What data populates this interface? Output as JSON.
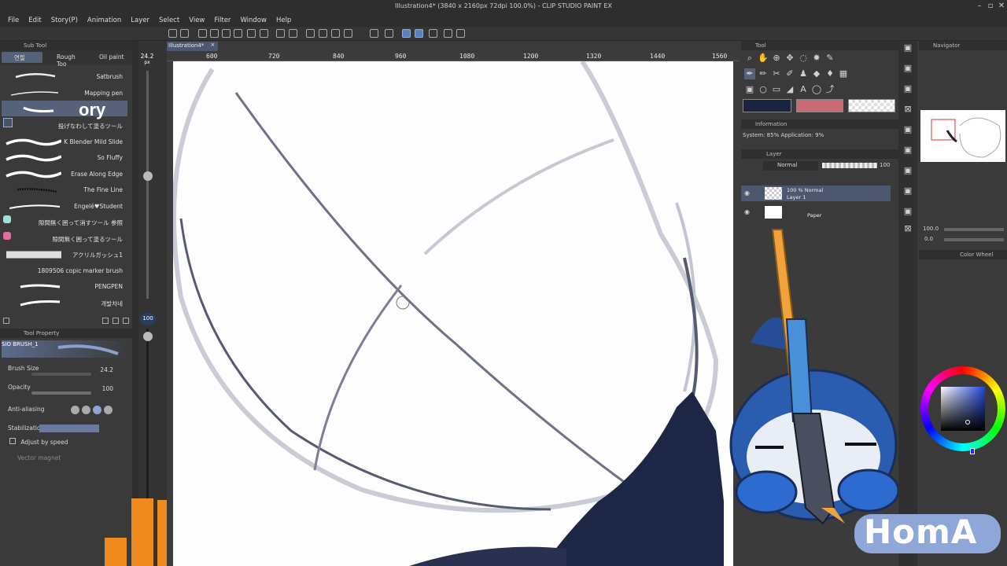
{
  "window": {
    "title": "Illustration4* (3840 x 2160px 72dpi 100.0%) - CLIP STUDIO PAINT EX"
  },
  "menu": [
    "File",
    "Edit",
    "Story(P)",
    "Animation",
    "Layer",
    "Select",
    "View",
    "Filter",
    "Window",
    "Help"
  ],
  "subtool": {
    "panel_title": "Sub Tool",
    "tabs": [
      "연필",
      "Rough Too",
      "Oil paint"
    ],
    "brushes": [
      "Satbrush",
      "Mapping pen",
      "",
      "投げなわして塗るツール",
      "K Blender Mild Slide",
      "So Fluffy",
      "Erase Along Edge",
      "The Fine Line",
      "Engelé♥Student",
      "隙間無く囲って消すツール 参照",
      "隙間無く囲って塗るツール",
      "アクリルガッシュ1",
      "1809506 copic marker brush",
      "PENGPEN",
      "개발차네"
    ],
    "selected_overlay_text": "ory",
    "brush_size_readout": "24.2",
    "brush_size_unit": "px",
    "opacity_readout": "100"
  },
  "tool_property": {
    "panel_title": "Tool Property",
    "brush_name": "SIO BRUSH_1",
    "brush_size_label": "Brush Size",
    "brush_size_value": "24.2",
    "opacity_label": "Opacity",
    "opacity_value": "100",
    "antialiasing_label": "Anti-aliasing",
    "stabilization_label": "Stabilization",
    "adjust_speed_label": "Adjust by speed",
    "vector_magnet_label": "Vector magnet"
  },
  "canvas": {
    "tab_label": "Illustration4*",
    "ruler_labels": [
      "600",
      "720",
      "840",
      "960",
      "1080",
      "1200",
      "1320",
      "1440",
      "1560"
    ]
  },
  "tool_panel": {
    "title": "Tool"
  },
  "info_panel": {
    "title": "Information",
    "system_text": "System: 85%  Application: 9%"
  },
  "layer_panel": {
    "title": "Layer",
    "blend_mode": "Normal",
    "opacity": "100",
    "layers": [
      {
        "line1": "100 % Normal",
        "line2": "Layer 1"
      },
      {
        "line1": "",
        "line2": "Paper"
      }
    ]
  },
  "navigator": {
    "title": "Navigator",
    "zoom": "100.0",
    "rotation": "0.0"
  },
  "color_wheel": {
    "title": "Color Wheel"
  },
  "colors": {
    "main_color": "#1a2340",
    "sub_color": "#c96b73",
    "accent": "#5a7fbf",
    "sticker_blue": "#2d5fb0",
    "pen_orange": "#f0a33c"
  },
  "overlay": {
    "logo_text": "HomA"
  }
}
